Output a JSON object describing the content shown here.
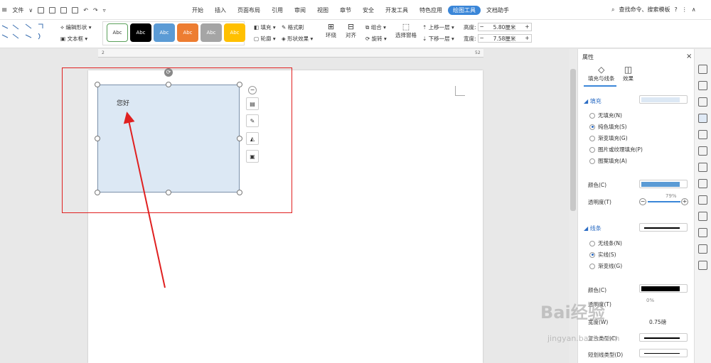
{
  "topbar": {
    "file_label": "文件",
    "tabs": [
      "开始",
      "插入",
      "页面布局",
      "引用",
      "审阅",
      "视图",
      "章节",
      "安全",
      "开发工具",
      "特色应用",
      "绘图工具",
      "文档助手"
    ],
    "active_tab": "绘图工具",
    "search": "查找命令、搜索模板",
    "help": "?"
  },
  "ribbon": {
    "edit_shape": "编辑形状",
    "text_box": "文本框",
    "style_label": "Abc",
    "fill": "填充",
    "format_painter": "格式刷",
    "outline": "轮廓",
    "shape_effect": "形状效果",
    "wrap": "环绕",
    "align": "对齐",
    "group": "组合",
    "rotate": "旋转",
    "select_pane": "选择窗格",
    "bring_forward": "上移一层",
    "send_backward": "下移一层",
    "height_label": "高度:",
    "height_value": "5.80厘米",
    "width_label": "宽度:",
    "width_value": "7.58厘米",
    "minus": "−",
    "plus": "+"
  },
  "styles": [
    {
      "bg": "#ffffff",
      "fg": "#333333",
      "border": "#5aa05a"
    },
    {
      "bg": "#000000",
      "fg": "#ffffff",
      "border": "#000000"
    },
    {
      "bg": "#5b9bd5",
      "fg": "#ffffff",
      "border": "#5b9bd5"
    },
    {
      "bg": "#ed7d31",
      "fg": "#ffffff",
      "border": "#ed7d31"
    },
    {
      "bg": "#a5a5a5",
      "fg": "#ffffff",
      "border": "#a5a5a5"
    },
    {
      "bg": "#ffc000",
      "fg": "#ffffff",
      "border": "#ffc000"
    }
  ],
  "ruler": {
    "left": "2",
    "right": "52"
  },
  "shape": {
    "text": "您好",
    "fill": "#dce8f4"
  },
  "panel": {
    "title": "属性",
    "close": "×",
    "tab_fill": "填充与线条",
    "tab_effect": "效果",
    "fill_section": "填充",
    "fill_options": [
      "无填充(N)",
      "纯色填充(S)",
      "渐变填充(G)",
      "图片或纹理填充(P)",
      "图案填充(A)"
    ],
    "fill_selected": 1,
    "color_label": "颜色(C)",
    "fill_color": "#5b9bd5",
    "transparency_label": "透明度(T)",
    "transparency_value": "79%",
    "line_section": "线条",
    "line_options": [
      "无线条(N)",
      "实线(S)",
      "渐变线(G)"
    ],
    "line_selected": 1,
    "line_color_label": "颜色(C)",
    "line_color": "#000000",
    "line_transparency_label": "透明度(T)",
    "line_transparency_value": "0%",
    "width_label": "宽度(W)",
    "width_value": "0.75磅",
    "compound_label": "复合类型(C)",
    "dash_label": "短划线类型(D)"
  },
  "watermark": {
    "logo": "Bai经验",
    "url": "jingyan.baidu.com"
  },
  "accent": "#3a86d8",
  "annotation": "#e02020"
}
